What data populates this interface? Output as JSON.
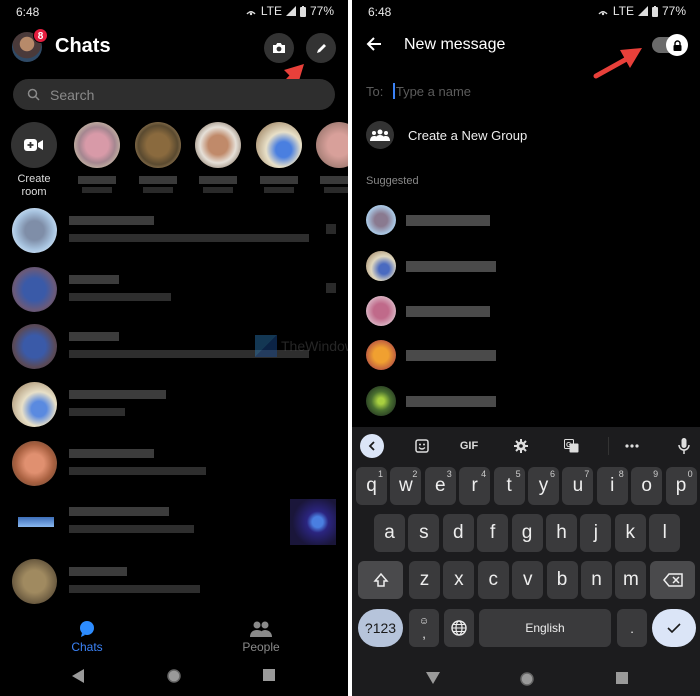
{
  "left": {
    "status": {
      "time": "6:48",
      "network": "LTE",
      "battery": "77%"
    },
    "header": {
      "title": "Chats",
      "badge_count": "8"
    },
    "search": {
      "placeholder": "Search"
    },
    "stories": {
      "create_room_label": "Create room",
      "count_visible": 5
    },
    "chat_list": {
      "count_visible": 7,
      "note": "names and messages pixelated"
    },
    "bottom_nav": [
      {
        "label": "Chats",
        "active": true
      },
      {
        "label": "People",
        "active": false
      }
    ],
    "watermark": "TheWindowsClub"
  },
  "right": {
    "status": {
      "time": "6:48",
      "network": "LTE",
      "battery": "77%"
    },
    "header": {
      "title": "New message",
      "secret_toggle_on": true
    },
    "to_field": {
      "label": "To:",
      "placeholder": "Type a name",
      "value": ""
    },
    "create_group_label": "Create a New Group",
    "suggested_label": "Suggested",
    "suggested_count": 5,
    "keyboard": {
      "toolbar": [
        "collapse",
        "sticker",
        "GIF",
        "settings",
        "translate",
        "more",
        "mic"
      ],
      "gif_label": "GIF",
      "row1": [
        {
          "k": "q",
          "n": "1"
        },
        {
          "k": "w",
          "n": "2"
        },
        {
          "k": "e",
          "n": "3"
        },
        {
          "k": "r",
          "n": "4"
        },
        {
          "k": "t",
          "n": "5"
        },
        {
          "k": "y",
          "n": "6"
        },
        {
          "k": "u",
          "n": "7"
        },
        {
          "k": "i",
          "n": "8"
        },
        {
          "k": "o",
          "n": "9"
        },
        {
          "k": "p",
          "n": "0"
        }
      ],
      "row2": [
        "a",
        "s",
        "d",
        "f",
        "g",
        "h",
        "j",
        "k",
        "l"
      ],
      "row3": [
        "z",
        "x",
        "c",
        "v",
        "b",
        "n",
        "m"
      ],
      "symbols_label": "?123",
      "comma_label": ",",
      "space_label": "English",
      "period_label": "."
    }
  },
  "colors": {
    "accent": "#0a84ff",
    "badge": "#e41e3f",
    "arrow": "#e8403a",
    "background": "#000000"
  }
}
